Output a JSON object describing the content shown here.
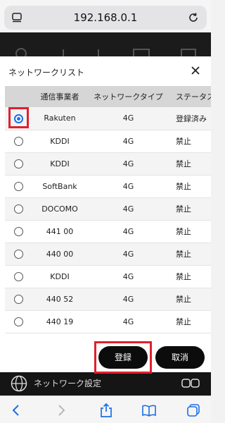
{
  "browser": {
    "url": "192.168.0.1",
    "icons": [
      "menu-icon",
      "reload-icon",
      "back-icon",
      "forward-icon",
      "share-icon",
      "bookmarks-icon",
      "tabs-icon"
    ]
  },
  "background_page": {
    "footer_label": "ネットワーク設定"
  },
  "modal": {
    "title": "ネットワークリスト",
    "columns": [
      "通信事業者",
      "ネットワークタイプ",
      "ステータス"
    ],
    "rows": [
      {
        "carrier": "Rakuten",
        "type": "4G",
        "status": "登録済み",
        "selected": true
      },
      {
        "carrier": "KDDI",
        "type": "4G",
        "status": "禁止",
        "selected": false
      },
      {
        "carrier": "KDDI",
        "type": "4G",
        "status": "禁止",
        "selected": false
      },
      {
        "carrier": "SoftBank",
        "type": "4G",
        "status": "禁止",
        "selected": false
      },
      {
        "carrier": "DOCOMO",
        "type": "4G",
        "status": "禁止",
        "selected": false
      },
      {
        "carrier": "441 00",
        "type": "4G",
        "status": "禁止",
        "selected": false
      },
      {
        "carrier": "440 00",
        "type": "4G",
        "status": "禁止",
        "selected": false
      },
      {
        "carrier": "KDDI",
        "type": "4G",
        "status": "禁止",
        "selected": false
      },
      {
        "carrier": "440 52",
        "type": "4G",
        "status": "禁止",
        "selected": false
      },
      {
        "carrier": "440 19",
        "type": "4G",
        "status": "禁止",
        "selected": false
      }
    ],
    "register_label": "登録",
    "cancel_label": "取消"
  },
  "colors": {
    "accent": "#1a6fe8",
    "highlight": "#e0202b",
    "button": "#0c0c0c"
  }
}
